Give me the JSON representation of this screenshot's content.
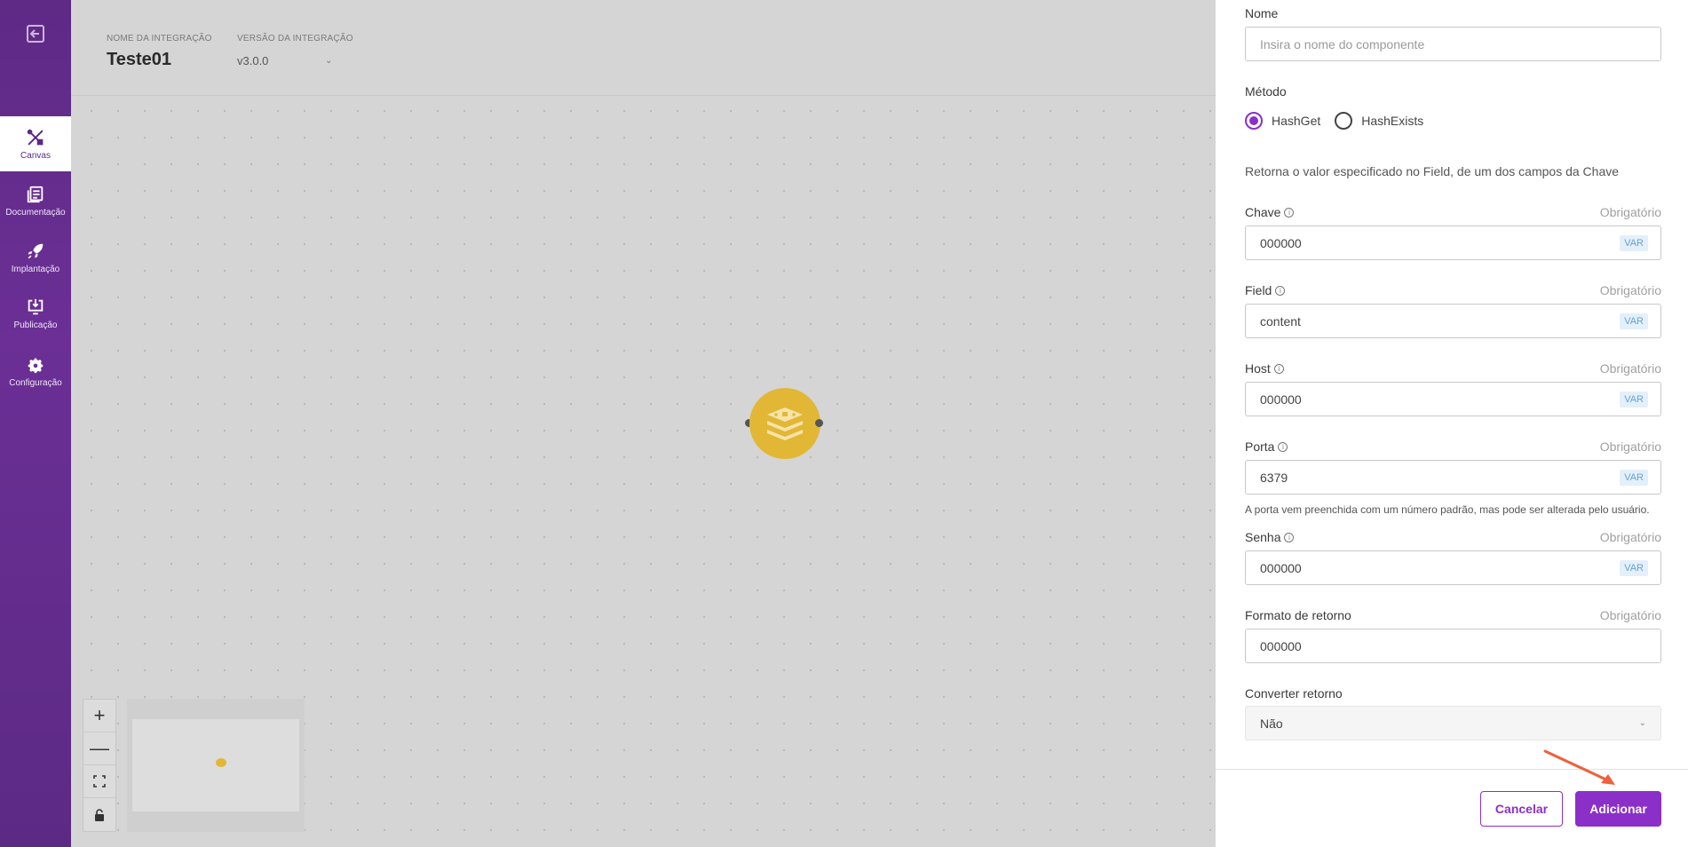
{
  "sidebar": {
    "items": [
      {
        "label": "Canvas",
        "icon": "tools-icon",
        "active": true
      },
      {
        "label": "Documentação",
        "icon": "document-icon"
      },
      {
        "label": "Implantação",
        "icon": "rocket-icon"
      },
      {
        "label": "Publicação",
        "icon": "download-monitor-icon"
      },
      {
        "label": "Configuração",
        "icon": "gear-icon"
      }
    ]
  },
  "header": {
    "name_label": "NOME DA INTEGRAÇÃO",
    "name_value": "Teste01",
    "version_label": "VERSÃO DA INTEGRAÇÃO",
    "version_value": "v3.0.0"
  },
  "canvas": {
    "node_icon": "redis-stack-icon",
    "zoom_controls": [
      "+",
      "—",
      "fit",
      "lock"
    ]
  },
  "form": {
    "nome": {
      "label": "Nome",
      "placeholder": "Insira o nome do componente"
    },
    "metodo": {
      "label": "Método",
      "options": [
        "HashGet",
        "HashExists"
      ],
      "selected": "HashGet"
    },
    "description": "Retorna o valor especificado no Field, de um dos campos da Chave",
    "required_text": "Obrigatório",
    "var_badge": "VAR",
    "chave": {
      "label": "Chave",
      "value": "000000"
    },
    "field": {
      "label": "Field",
      "value": "content"
    },
    "host": {
      "label": "Host",
      "value": "000000"
    },
    "porta": {
      "label": "Porta",
      "value": "6379",
      "hint": "A porta vem preenchida com um número padrão, mas pode ser alterada pelo usuário."
    },
    "senha": {
      "label": "Senha",
      "value": "000000"
    },
    "formato": {
      "label": "Formato de retorno",
      "value": "000000"
    },
    "converter": {
      "label": "Converter retorno",
      "value": "Não"
    }
  },
  "footer": {
    "cancel_label": "Cancelar",
    "add_label": "Adicionar"
  },
  "colors": {
    "brand_purple": "#8b2fc9",
    "sidebar": "#5e2a86",
    "node": "#e2b736",
    "arrow": "#f0603a"
  }
}
